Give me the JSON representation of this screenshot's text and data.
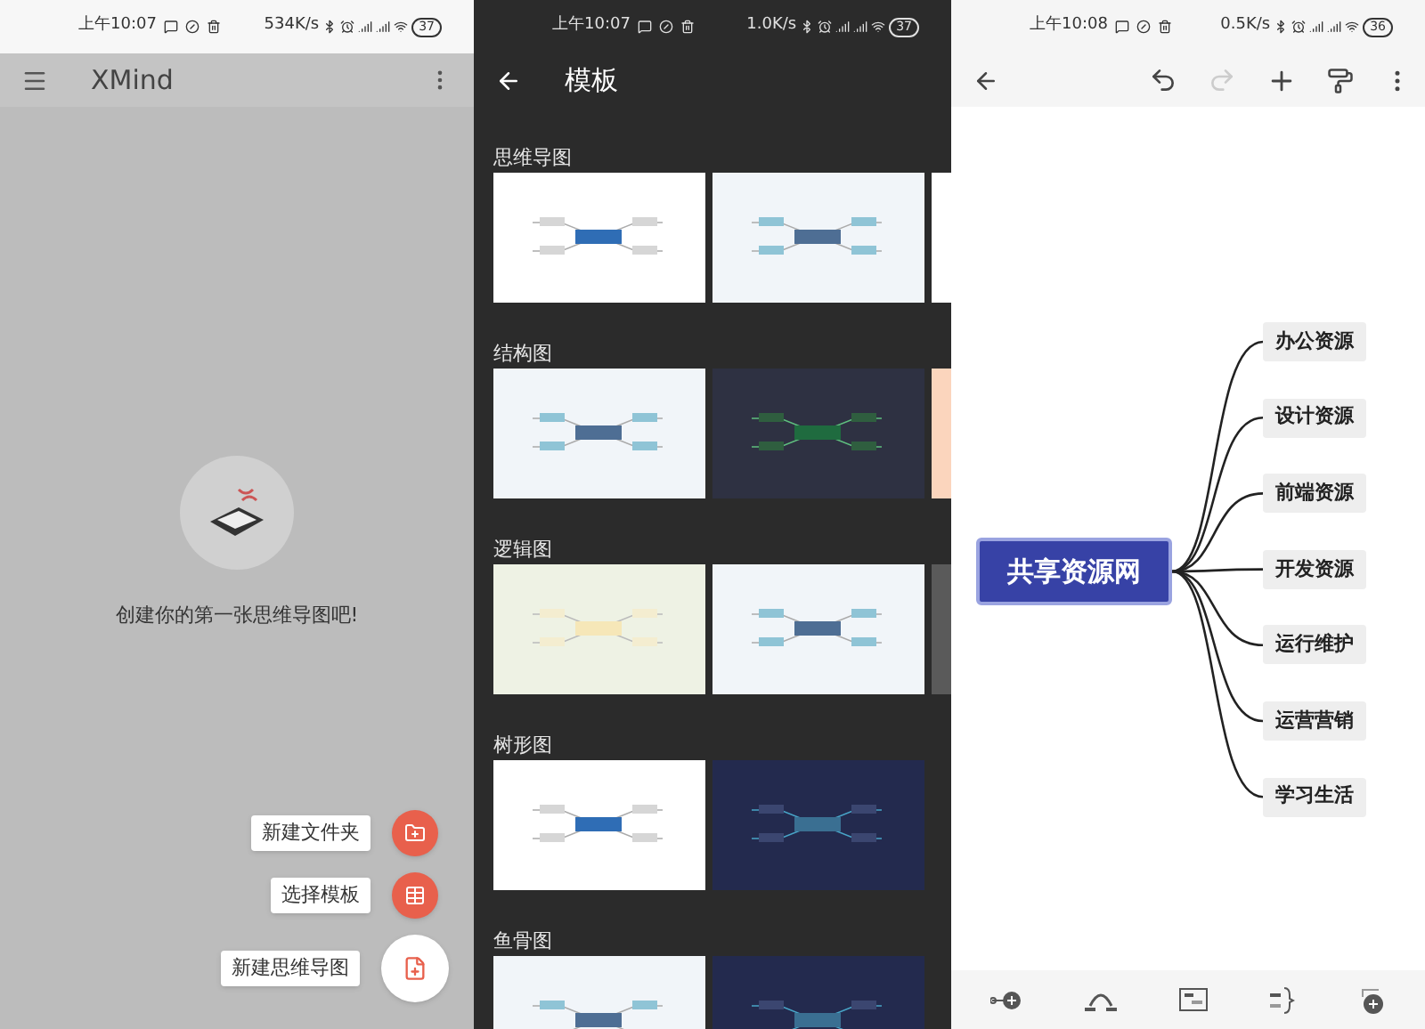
{
  "home": {
    "status_bar": {
      "time": "上午10:07",
      "speed": "534K/s",
      "battery": "37"
    },
    "title": "XMind",
    "empty_message": "创建你的第一张思维导图吧!",
    "fab_actions": [
      {
        "label": "新建文件夹",
        "kind": "folder"
      },
      {
        "label": "选择模板",
        "kind": "template"
      },
      {
        "label": "新建思维导图",
        "kind": "new"
      }
    ]
  },
  "templates": {
    "status_bar": {
      "time": "上午10:07",
      "speed": "1.0K/s",
      "battery": "37"
    },
    "title": "模板",
    "sections": [
      {
        "title": "思维导图",
        "previews": [
          {
            "kind": "white"
          },
          {
            "kind": "pale"
          },
          {
            "kind": "white"
          }
        ]
      },
      {
        "title": "结构图",
        "previews": [
          {
            "kind": "pale"
          },
          {
            "kind": "slate"
          },
          {
            "kind": "peach"
          }
        ]
      },
      {
        "title": "逻辑图",
        "previews": [
          {
            "kind": "sage"
          },
          {
            "kind": "pale"
          },
          {
            "kind": "gray"
          }
        ]
      },
      {
        "title": "树形图",
        "previews": [
          {
            "kind": "white"
          },
          {
            "kind": "navy"
          }
        ]
      },
      {
        "title": "鱼骨图",
        "previews": [
          {
            "kind": "pale"
          },
          {
            "kind": "navy"
          }
        ]
      }
    ]
  },
  "editor": {
    "status_bar": {
      "time": "上午10:08",
      "speed": "0.5K/s",
      "battery": "36"
    },
    "toolbar": [
      {
        "kind": "undo",
        "disabled": false
      },
      {
        "kind": "redo",
        "disabled": true
      },
      {
        "kind": "add",
        "disabled": false
      },
      {
        "kind": "format",
        "disabled": false
      },
      {
        "kind": "more",
        "disabled": false
      }
    ],
    "central_topic": "共享资源网",
    "topics": [
      "办公资源",
      "设计资源",
      "前端资源",
      "开发资源",
      "运行维护",
      "运营营销",
      "学习生活"
    ],
    "bottom_tools": [
      {
        "kind": "subtopic"
      },
      {
        "kind": "relationship"
      },
      {
        "kind": "summary_box"
      },
      {
        "kind": "boundary"
      },
      {
        "kind": "floating"
      }
    ]
  }
}
